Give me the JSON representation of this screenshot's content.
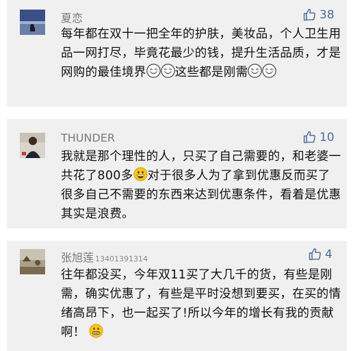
{
  "comments": [
    {
      "username": "夏恋",
      "username_suffix": "",
      "likes": "38",
      "segments": [
        {
          "t": "text",
          "v": "每年都在双十一把全年的护肤，美妆品，个人卫生用品一网打尽，毕竟花最少的钱，提升生活品质，才是网购的最佳境界"
        },
        {
          "t": "emoji",
          "v": "smiling-face"
        },
        {
          "t": "emoji",
          "v": "smiling-face"
        },
        {
          "t": "text",
          "v": "这些都是刚需"
        },
        {
          "t": "emoji",
          "v": "smiling-face"
        },
        {
          "t": "emoji",
          "v": "smiling-face"
        }
      ]
    },
    {
      "username": "THUNDER",
      "username_suffix": "",
      "likes": "10",
      "segments": [
        {
          "t": "text",
          "v": "我就是那个理性的人，只买了自己需要的，和老婆一共花了800多"
        },
        {
          "t": "emoji",
          "v": "grinning-face"
        },
        {
          "t": "text",
          "v": "对于很多人为了拿到优惠反而买了很多自己不需要的东西来达到优惠条件，看着是优惠其实是浪费。"
        }
      ]
    },
    {
      "username": "张旭莲",
      "username_suffix": "13401391314",
      "likes": "4",
      "segments": [
        {
          "t": "text",
          "v": "往年都没买，今年双11买了大几千的货，有些是刚需，确实优惠了，有些是平时没想到要买，在买的情绪高昂下，也一起买了!所以今年的增长有我的贡献啊！ "
        },
        {
          "t": "emoji",
          "v": "grimacing-face"
        }
      ]
    }
  ],
  "colors": {
    "card_bg": "#f0f0f0",
    "username": "#7a7a7a",
    "like": "#4b6e98",
    "text": "#111111"
  },
  "icons": {
    "like": "thumbs-up-icon"
  }
}
